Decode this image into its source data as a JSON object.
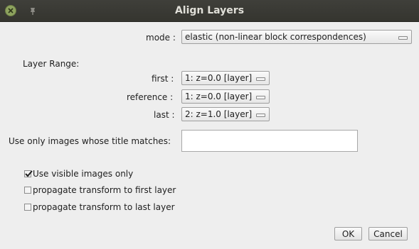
{
  "window": {
    "title": "Align Layers"
  },
  "mode": {
    "label": "mode :",
    "value": "elastic (non-linear block correspondences)"
  },
  "layer_range": {
    "heading": "Layer Range:",
    "first": {
      "label": "first :",
      "value": "1:  z=0.0 [layer]"
    },
    "reference": {
      "label": "reference :",
      "value": "1:  z=0.0 [layer]"
    },
    "last": {
      "label": "last :",
      "value": "2:  z=1.0 [layer]"
    }
  },
  "title_filter": {
    "label": "Use only images whose title matches:",
    "value": ""
  },
  "checkboxes": [
    {
      "label": "Use visible images only",
      "checked": true
    },
    {
      "label": "propagate transform to first layer",
      "checked": false
    },
    {
      "label": "propagate transform to last layer",
      "checked": false
    }
  ],
  "buttons": {
    "ok": "OK",
    "cancel": "Cancel"
  },
  "colors": {
    "titlebar": "#3c3b37",
    "close": "#8ea35f",
    "background": "#eeeeee"
  }
}
